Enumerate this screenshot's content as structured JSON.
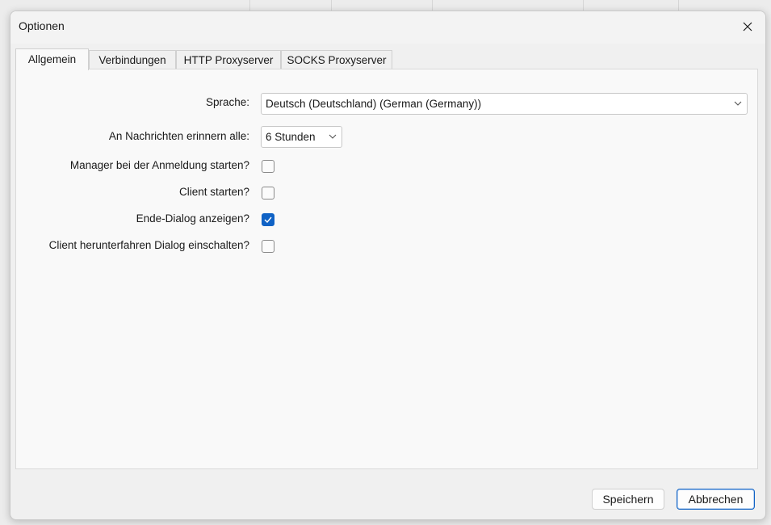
{
  "window": {
    "title": "Optionen"
  },
  "tabs": [
    {
      "label": "Allgemein",
      "active": true
    },
    {
      "label": "Verbindungen",
      "active": false
    },
    {
      "label": "HTTP Proxyserver",
      "active": false
    },
    {
      "label": "SOCKS Proxyserver",
      "active": false
    }
  ],
  "form": {
    "language": {
      "label": "Sprache:",
      "value": "Deutsch (Deutschland) (German (Germany))"
    },
    "reminder": {
      "label": "An Nachrichten erinnern alle:",
      "value": "6 Stunden"
    },
    "start_manager": {
      "label": "Manager bei der Anmeldung starten?",
      "checked": false
    },
    "start_client": {
      "label": "Client starten?",
      "checked": false
    },
    "end_dialog": {
      "label": "Ende-Dialog anzeigen?",
      "checked": true
    },
    "shutdown_dialog": {
      "label": "Client herunterfahren Dialog einschalten?",
      "checked": false
    }
  },
  "buttons": {
    "save": "Speichern",
    "cancel": "Abbrechen"
  },
  "colors": {
    "accent": "#0f62c5",
    "panel": "#f9f9f9",
    "dialog": "#f0f0f0"
  },
  "icons": {
    "close": "close-icon",
    "dropdown": "chevron-down-icon",
    "check": "checkmark-icon"
  }
}
